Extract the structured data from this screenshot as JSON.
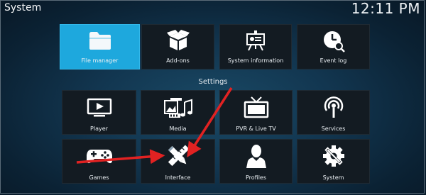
{
  "header": {
    "title": "System",
    "clock": "12:11 PM"
  },
  "top_row": [
    {
      "label": "File manager",
      "icon": "folder-icon",
      "focused": true
    },
    {
      "label": "Add-ons",
      "icon": "box-icon"
    },
    {
      "label": "System information",
      "icon": "presentation-icon"
    },
    {
      "label": "Event log",
      "icon": "clock-search-icon"
    }
  ],
  "settings": {
    "title": "Settings",
    "items": [
      {
        "label": "Player",
        "icon": "tv-play-icon"
      },
      {
        "label": "Media",
        "icon": "media-icon"
      },
      {
        "label": "PVR & Live TV",
        "icon": "tv-antenna-icon"
      },
      {
        "label": "Services",
        "icon": "broadcast-icon"
      },
      {
        "label": "Games",
        "icon": "gamepad-icon"
      },
      {
        "label": "Interface",
        "icon": "pencil-ruler-icon"
      },
      {
        "label": "Profiles",
        "icon": "person-icon"
      },
      {
        "label": "System",
        "icon": "gear-wrench-icon"
      }
    ]
  },
  "colors": {
    "focus": "#1ea8dd",
    "tile": "#131b22",
    "arrow": "#e22222"
  }
}
